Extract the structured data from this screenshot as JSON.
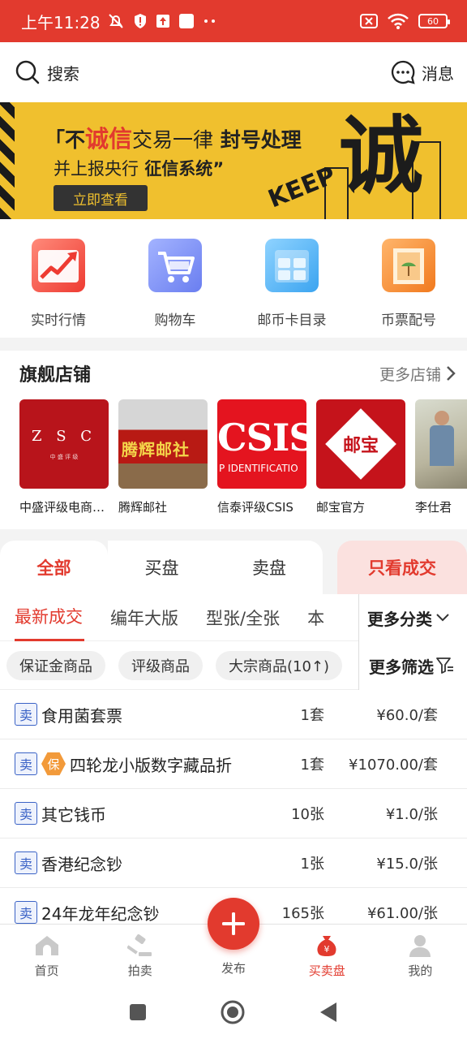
{
  "status": {
    "time": "上午11:28",
    "battery": "60"
  },
  "header": {
    "search_label": "搜索",
    "message_label": "消息"
  },
  "banner": {
    "line1_prefix": "不",
    "line1_red": "诚信",
    "line1_rest": "交易一律",
    "line1_bold": "封号处理",
    "line2": "并上报央行",
    "line2_bold": "征信系统",
    "button": "立即查看",
    "big_char": "诚",
    "keep_text": "KEEP"
  },
  "quick_links": [
    {
      "label": "实时行情",
      "icon": "trend-chart-icon"
    },
    {
      "label": "购物车",
      "icon": "shopping-cart-icon"
    },
    {
      "label": "邮币卡目录",
      "icon": "catalog-grid-icon"
    },
    {
      "label": "币票配号",
      "icon": "stamp-icon"
    }
  ],
  "shops": {
    "title": "旗舰店铺",
    "more": "更多店铺",
    "items": [
      {
        "name": "中盛评级电商旗舰店",
        "logo_text": "Z S C",
        "logo_sub": "中 盛 评 级"
      },
      {
        "name": "腾辉邮社",
        "logo_text": "腾辉邮社"
      },
      {
        "name": "信泰评级CSIS",
        "logo_text": "CSIS",
        "logo_sub": "P IDENTIFICATIO"
      },
      {
        "name": "邮宝官方",
        "logo_text": "邮宝"
      },
      {
        "name": "李仕君"
      }
    ]
  },
  "market_tabs": [
    "全部",
    "买盘",
    "卖盘",
    "只看成交"
  ],
  "sub_tabs": [
    "最新成交",
    "编年大版",
    "型张/全张",
    "本"
  ],
  "more_category": "更多分类",
  "filter_chips": [
    "保证金商品",
    "评级商品",
    "大宗商品(10↑)"
  ],
  "more_filter": "更多筛选",
  "listings": [
    {
      "tag": "卖",
      "name": "食用菌套票",
      "qty": "1套",
      "price": "¥60.0/套",
      "guarantee": false
    },
    {
      "tag": "卖",
      "badge": "保",
      "name": "四轮龙小版数字藏品折",
      "qty": "1套",
      "price": "¥1070.00/套",
      "guarantee": true
    },
    {
      "tag": "卖",
      "name": "其它钱币",
      "qty": "10张",
      "price": "¥1.0/张",
      "guarantee": false
    },
    {
      "tag": "卖",
      "name": "香港纪念钞",
      "qty": "1张",
      "price": "¥15.0/张",
      "guarantee": false
    },
    {
      "tag": "卖",
      "name": "24年龙年纪念钞",
      "qty": "165张",
      "price": "¥61.00/张",
      "guarantee": false
    }
  ],
  "bottom_nav": [
    {
      "label": "首页",
      "icon": "home-icon"
    },
    {
      "label": "拍卖",
      "icon": "gavel-icon"
    },
    {
      "label": "发布",
      "icon": "plus-icon"
    },
    {
      "label": "买卖盘",
      "icon": "money-bag-icon",
      "active": true
    },
    {
      "label": "我的",
      "icon": "user-icon"
    }
  ],
  "colors": {
    "brand": "#e23a2e",
    "banner": "#f0c02e",
    "tag_blue": "#3a62c6",
    "guarantee": "#f29a3a"
  }
}
